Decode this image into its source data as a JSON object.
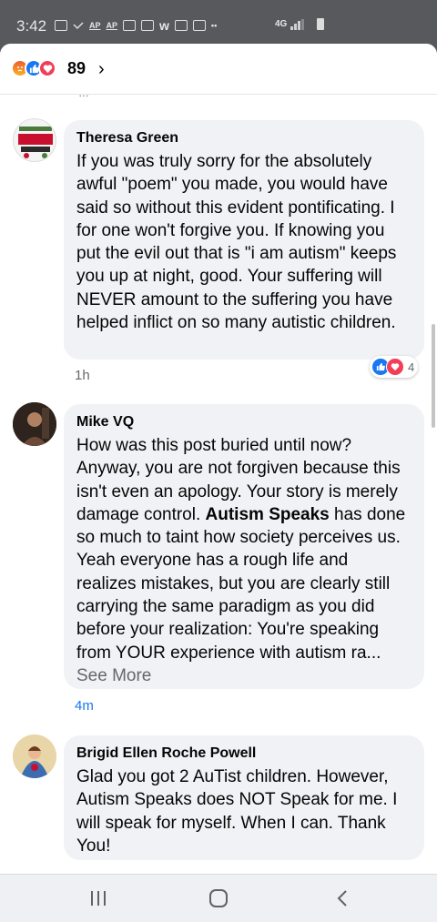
{
  "status_bar": {
    "time": "3:42",
    "icons": [
      "message-icon",
      "missed-call-icon",
      "ap-news-icon",
      "ap-news-icon",
      "gallery-icon",
      "video-icon",
      "w-app-icon",
      "image-icon",
      "calendar-icon",
      "more-dots-icon"
    ],
    "ap_label": "AP",
    "w_label": "w",
    "more_dots": "••",
    "network": "4G",
    "signal_icon": "signal-icon",
    "battery_icon": "battery-icon"
  },
  "reactions_header": {
    "icons": [
      "angry-reaction-icon",
      "like-reaction-icon",
      "love-reaction-icon"
    ],
    "count": "89",
    "chevron": "›",
    "earlier_ellipsis": "…"
  },
  "comments": [
    {
      "author": "Theresa Green",
      "text": "If you was truly sorry for the absolutely awful \"poem\" you made, you would have said so without this evident pontificating. I for one won't forgive you. If knowing you put the evil out that is \"i am autism\" keeps you up at night, good. Your suffering will NEVER amount to the suffering you have helped inflict on so many autistic children.",
      "time": "1h",
      "reactions": {
        "icons": [
          "like-reaction-icon",
          "love-reaction-icon"
        ],
        "count": "4"
      }
    },
    {
      "author": "Mike VQ",
      "text_before": "How was this post buried until now? Anyway, you are not forgiven because this isn't even an apology. Your story is merely damage control. ",
      "text_bold": "Autism Speaks",
      "text_after": " has done so much to taint how society perceives us.  Yeah everyone has a rough life and realizes mistakes, but you are clearly still carrying the same paradigm as you did before your realization: You're speaking from YOUR experience with autism ra... ",
      "see_more": "See More",
      "time": "4m"
    },
    {
      "author": "Brigid Ellen Roche Powell",
      "text": "Glad you got 2 AuTist children. However, Autism Speaks does NOT Speak for me. I will speak for myself. When I can. Thank You!"
    }
  ],
  "nav_bar": {
    "recent_apps_icon": "recent-apps-icon",
    "home_icon": "home-icon",
    "back_icon": "back-icon"
  },
  "colors": {
    "status_bg": "#58595c",
    "bubble_bg": "#f0f2f5",
    "link_blue": "#1877f2",
    "like_blue": "#1877f2",
    "love_red": "#f33e58",
    "muted_text": "#65676b"
  }
}
